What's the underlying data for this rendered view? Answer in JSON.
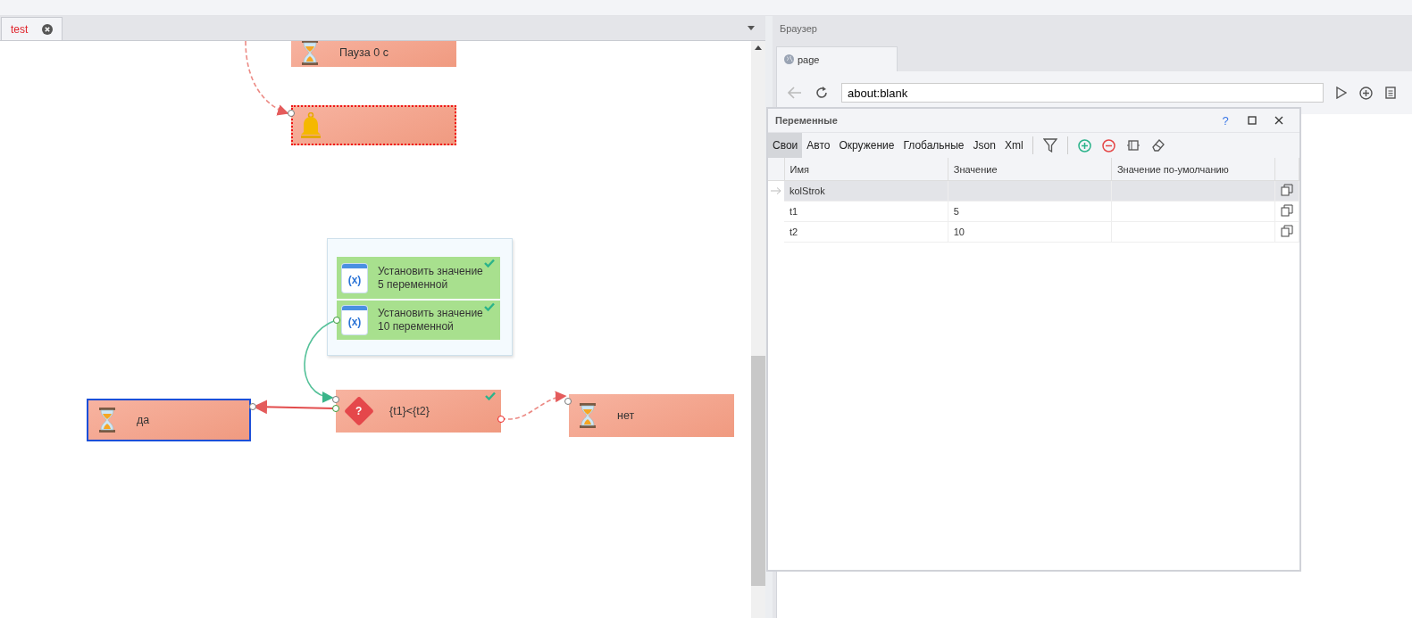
{
  "editor": {
    "tabs": [
      {
        "label": "test",
        "selected": true
      }
    ],
    "nodes": [
      {
        "kind": "pause",
        "label": "Пауза 0 с",
        "selected": false,
        "error": false,
        "done": false
      },
      {
        "kind": "bell",
        "selected": false,
        "error": true,
        "done": false
      },
      {
        "kind": "set",
        "icon_text": "(x)",
        "label": "Установить значение\n5 переменной",
        "selected": false,
        "error": false,
        "done": true
      },
      {
        "kind": "set",
        "icon_text": "(x)",
        "label": "Установить значение\n10 переменной",
        "selected": false,
        "error": false,
        "done": true
      },
      {
        "kind": "condition",
        "icon_text": "?",
        "label": "{t1}<{t2}",
        "selected": false,
        "error": false,
        "done": true
      },
      {
        "kind": "pause",
        "label": "да",
        "selected": true,
        "error": false,
        "done": false
      },
      {
        "kind": "pause",
        "label": "нет",
        "selected": false,
        "error": false,
        "done": false
      }
    ]
  },
  "browser": {
    "title": "Браузер",
    "tabs": [
      {
        "label": "page",
        "selected": true
      }
    ],
    "back_disabled": true,
    "url": "about:blank"
  },
  "variables": {
    "title": "Переменные",
    "help": "?",
    "tabs": [
      {
        "label": "Свои",
        "selected": true
      },
      {
        "label": "Авто",
        "selected": false
      },
      {
        "label": "Окружение",
        "selected": false
      },
      {
        "label": "Глобальные",
        "selected": false
      },
      {
        "label": "Json",
        "selected": false
      },
      {
        "label": "Xml",
        "selected": false
      }
    ],
    "columns": [
      "Имя",
      "Значение",
      "Значение по-умолчанию"
    ],
    "rows": [
      {
        "name": "kolStrok",
        "selected": true
      },
      {
        "name": "t1",
        "value": "5",
        "selected": false
      },
      {
        "name": "t2",
        "value": "10",
        "selected": false
      }
    ]
  }
}
